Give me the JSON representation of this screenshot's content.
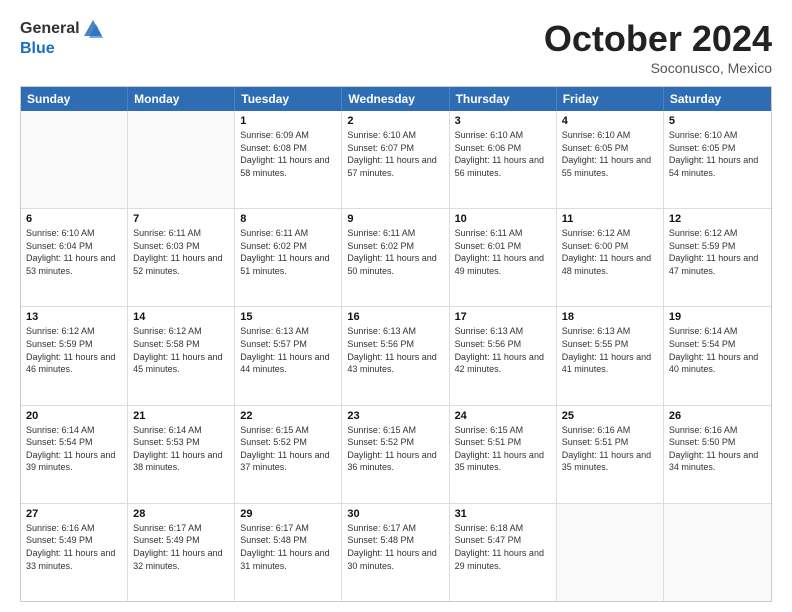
{
  "header": {
    "logo_general": "General",
    "logo_blue": "Blue",
    "month": "October 2024",
    "location": "Soconusco, Mexico"
  },
  "weekdays": [
    "Sunday",
    "Monday",
    "Tuesday",
    "Wednesday",
    "Thursday",
    "Friday",
    "Saturday"
  ],
  "weeks": [
    [
      {
        "day": "",
        "info": ""
      },
      {
        "day": "",
        "info": ""
      },
      {
        "day": "1",
        "info": "Sunrise: 6:09 AM\nSunset: 6:08 PM\nDaylight: 11 hours and 58 minutes."
      },
      {
        "day": "2",
        "info": "Sunrise: 6:10 AM\nSunset: 6:07 PM\nDaylight: 11 hours and 57 minutes."
      },
      {
        "day": "3",
        "info": "Sunrise: 6:10 AM\nSunset: 6:06 PM\nDaylight: 11 hours and 56 minutes."
      },
      {
        "day": "4",
        "info": "Sunrise: 6:10 AM\nSunset: 6:05 PM\nDaylight: 11 hours and 55 minutes."
      },
      {
        "day": "5",
        "info": "Sunrise: 6:10 AM\nSunset: 6:05 PM\nDaylight: 11 hours and 54 minutes."
      }
    ],
    [
      {
        "day": "6",
        "info": "Sunrise: 6:10 AM\nSunset: 6:04 PM\nDaylight: 11 hours and 53 minutes."
      },
      {
        "day": "7",
        "info": "Sunrise: 6:11 AM\nSunset: 6:03 PM\nDaylight: 11 hours and 52 minutes."
      },
      {
        "day": "8",
        "info": "Sunrise: 6:11 AM\nSunset: 6:02 PM\nDaylight: 11 hours and 51 minutes."
      },
      {
        "day": "9",
        "info": "Sunrise: 6:11 AM\nSunset: 6:02 PM\nDaylight: 11 hours and 50 minutes."
      },
      {
        "day": "10",
        "info": "Sunrise: 6:11 AM\nSunset: 6:01 PM\nDaylight: 11 hours and 49 minutes."
      },
      {
        "day": "11",
        "info": "Sunrise: 6:12 AM\nSunset: 6:00 PM\nDaylight: 11 hours and 48 minutes."
      },
      {
        "day": "12",
        "info": "Sunrise: 6:12 AM\nSunset: 5:59 PM\nDaylight: 11 hours and 47 minutes."
      }
    ],
    [
      {
        "day": "13",
        "info": "Sunrise: 6:12 AM\nSunset: 5:59 PM\nDaylight: 11 hours and 46 minutes."
      },
      {
        "day": "14",
        "info": "Sunrise: 6:12 AM\nSunset: 5:58 PM\nDaylight: 11 hours and 45 minutes."
      },
      {
        "day": "15",
        "info": "Sunrise: 6:13 AM\nSunset: 5:57 PM\nDaylight: 11 hours and 44 minutes."
      },
      {
        "day": "16",
        "info": "Sunrise: 6:13 AM\nSunset: 5:56 PM\nDaylight: 11 hours and 43 minutes."
      },
      {
        "day": "17",
        "info": "Sunrise: 6:13 AM\nSunset: 5:56 PM\nDaylight: 11 hours and 42 minutes."
      },
      {
        "day": "18",
        "info": "Sunrise: 6:13 AM\nSunset: 5:55 PM\nDaylight: 11 hours and 41 minutes."
      },
      {
        "day": "19",
        "info": "Sunrise: 6:14 AM\nSunset: 5:54 PM\nDaylight: 11 hours and 40 minutes."
      }
    ],
    [
      {
        "day": "20",
        "info": "Sunrise: 6:14 AM\nSunset: 5:54 PM\nDaylight: 11 hours and 39 minutes."
      },
      {
        "day": "21",
        "info": "Sunrise: 6:14 AM\nSunset: 5:53 PM\nDaylight: 11 hours and 38 minutes."
      },
      {
        "day": "22",
        "info": "Sunrise: 6:15 AM\nSunset: 5:52 PM\nDaylight: 11 hours and 37 minutes."
      },
      {
        "day": "23",
        "info": "Sunrise: 6:15 AM\nSunset: 5:52 PM\nDaylight: 11 hours and 36 minutes."
      },
      {
        "day": "24",
        "info": "Sunrise: 6:15 AM\nSunset: 5:51 PM\nDaylight: 11 hours and 35 minutes."
      },
      {
        "day": "25",
        "info": "Sunrise: 6:16 AM\nSunset: 5:51 PM\nDaylight: 11 hours and 35 minutes."
      },
      {
        "day": "26",
        "info": "Sunrise: 6:16 AM\nSunset: 5:50 PM\nDaylight: 11 hours and 34 minutes."
      }
    ],
    [
      {
        "day": "27",
        "info": "Sunrise: 6:16 AM\nSunset: 5:49 PM\nDaylight: 11 hours and 33 minutes."
      },
      {
        "day": "28",
        "info": "Sunrise: 6:17 AM\nSunset: 5:49 PM\nDaylight: 11 hours and 32 minutes."
      },
      {
        "day": "29",
        "info": "Sunrise: 6:17 AM\nSunset: 5:48 PM\nDaylight: 11 hours and 31 minutes."
      },
      {
        "day": "30",
        "info": "Sunrise: 6:17 AM\nSunset: 5:48 PM\nDaylight: 11 hours and 30 minutes."
      },
      {
        "day": "31",
        "info": "Sunrise: 6:18 AM\nSunset: 5:47 PM\nDaylight: 11 hours and 29 minutes."
      },
      {
        "day": "",
        "info": ""
      },
      {
        "day": "",
        "info": ""
      }
    ]
  ]
}
